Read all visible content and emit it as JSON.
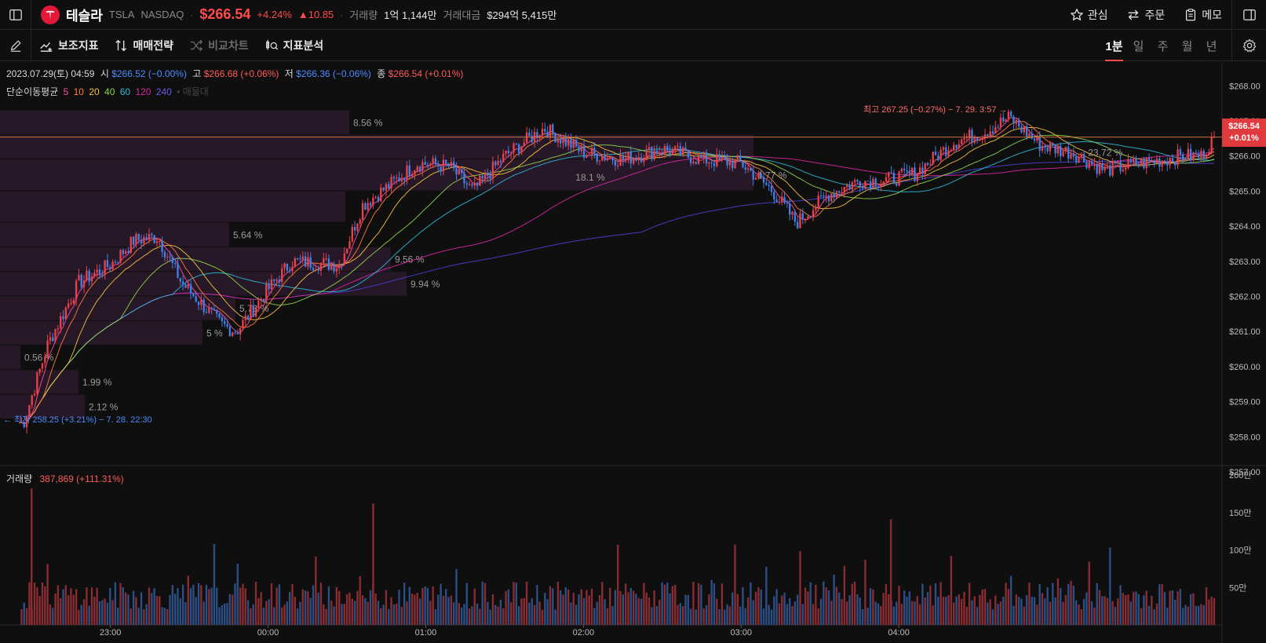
{
  "header": {
    "name": "테슬라",
    "ticker": "TSLA",
    "exchange": "NASDAQ",
    "price": "$266.54",
    "change_pct": "+4.24%",
    "change_abs": "▲10.85",
    "volume_label": "거래량",
    "volume_value": "1억 1,144만",
    "amount_label": "거래대금",
    "amount_value": "$294억 5,415만"
  },
  "top_actions": {
    "watchlist": "관심",
    "order": "주문",
    "memo": "메모"
  },
  "toolbar": {
    "indicators": "보조지표",
    "strategy": "매매전략",
    "compare": "비교차트",
    "analysis": "지표분석"
  },
  "periods": [
    "1분",
    "일",
    "주",
    "월",
    "년"
  ],
  "ohlc": {
    "datetime": "2023.07.29(토) 04:59",
    "open_label": "시",
    "open": "$266.52 (−0.00%)",
    "high_label": "고",
    "high": "$266.68 (+0.06%)",
    "low_label": "저",
    "low": "$266.36 (−0.06%)",
    "close_label": "종",
    "close": "$266.54 (+0.01%)"
  },
  "ma_legend": {
    "label": "단순이동평균",
    "periods": [
      "5",
      "10",
      "20",
      "40",
      "60",
      "120",
      "240"
    ],
    "suffix": "• 매물대"
  },
  "volume_legend": {
    "label": "거래량",
    "value": "387,869 (+111.31%)"
  },
  "price_tag": {
    "price": "$266.54",
    "pct": "+0.01%"
  },
  "annotations": {
    "high": "최고 267.25 (−0.27%) − 7. 29. 3:57 →",
    "low": "← 최저 258.25 (+3.21%) − 7. 28. 22:30"
  },
  "colors": {
    "up": "#e8414b",
    "down": "#3f7fe6",
    "ma5": "#ff4d9a",
    "ma10": "#ff7a3d",
    "ma20": "#f5c242",
    "ma40": "#8fd14f",
    "ma60": "#2fb7d6",
    "ma120": "#d6289e",
    "ma240": "#4a3fd1"
  },
  "chart_data": {
    "type": "candlestick",
    "price_axis": [
      "$268.00",
      "$267.00",
      "$266.00",
      "$265.00",
      "$264.00",
      "$263.00",
      "$262.00",
      "$261.00",
      "$260.00",
      "$259.00",
      "$258.00",
      "$257.00"
    ],
    "price_range": [
      257,
      268.5
    ],
    "time_axis": [
      "23:00",
      "00:00",
      "01:00",
      "02:00",
      "03:00",
      "04:00"
    ],
    "volume_axis": [
      "200만",
      "150만",
      "100만",
      "50만"
    ],
    "volume_range": [
      0,
      2000000
    ],
    "close_path": [
      [
        22.45,
        258.4
      ],
      [
        22.6,
        260.6
      ],
      [
        22.8,
        262.4
      ],
      [
        23.0,
        262.9
      ],
      [
        23.15,
        263.6
      ],
      [
        23.3,
        263.7
      ],
      [
        23.45,
        262.4
      ],
      [
        23.7,
        261.2
      ],
      [
        23.8,
        261.0
      ],
      [
        24.0,
        262.2
      ],
      [
        24.15,
        263.0
      ],
      [
        24.45,
        262.9
      ],
      [
        24.6,
        264.6
      ],
      [
        24.75,
        265.1
      ],
      [
        24.95,
        265.8
      ],
      [
        25.15,
        265.7
      ],
      [
        25.3,
        265.0
      ],
      [
        25.5,
        266.0
      ],
      [
        25.75,
        266.8
      ],
      [
        26.0,
        266.1
      ],
      [
        26.25,
        265.9
      ],
      [
        26.5,
        266.2
      ],
      [
        26.75,
        265.9
      ],
      [
        27.0,
        265.8
      ],
      [
        27.2,
        265.0
      ],
      [
        27.35,
        264.1
      ],
      [
        27.55,
        264.9
      ],
      [
        27.75,
        265.3
      ],
      [
        27.9,
        265.3
      ],
      [
        28.1,
        265.5
      ],
      [
        28.35,
        266.4
      ],
      [
        28.55,
        266.7
      ],
      [
        28.7,
        267.1
      ],
      [
        28.9,
        266.3
      ],
      [
        29.1,
        266.1
      ],
      [
        29.3,
        265.6
      ],
      [
        29.55,
        265.8
      ],
      [
        29.8,
        266.0
      ],
      [
        29.92,
        266.0
      ],
      [
        30.0,
        266.54
      ]
    ],
    "volume_spikes": [
      {
        "time": "22:30",
        "volume": 1820000
      },
      {
        "time": "00:40",
        "volume": 1620000
      },
      {
        "time": "03:57",
        "volume": 1410000
      }
    ],
    "volume_profile": [
      "8.56 %",
      "1.77 %",
      "5.64 %",
      "9.56 %",
      "9.94 %",
      "5.78 %",
      "5 %",
      "0.56 %",
      "1.99 %",
      "2.12 %",
      "18.1 %",
      "23.72 %"
    ],
    "last_volume": "387,869"
  }
}
